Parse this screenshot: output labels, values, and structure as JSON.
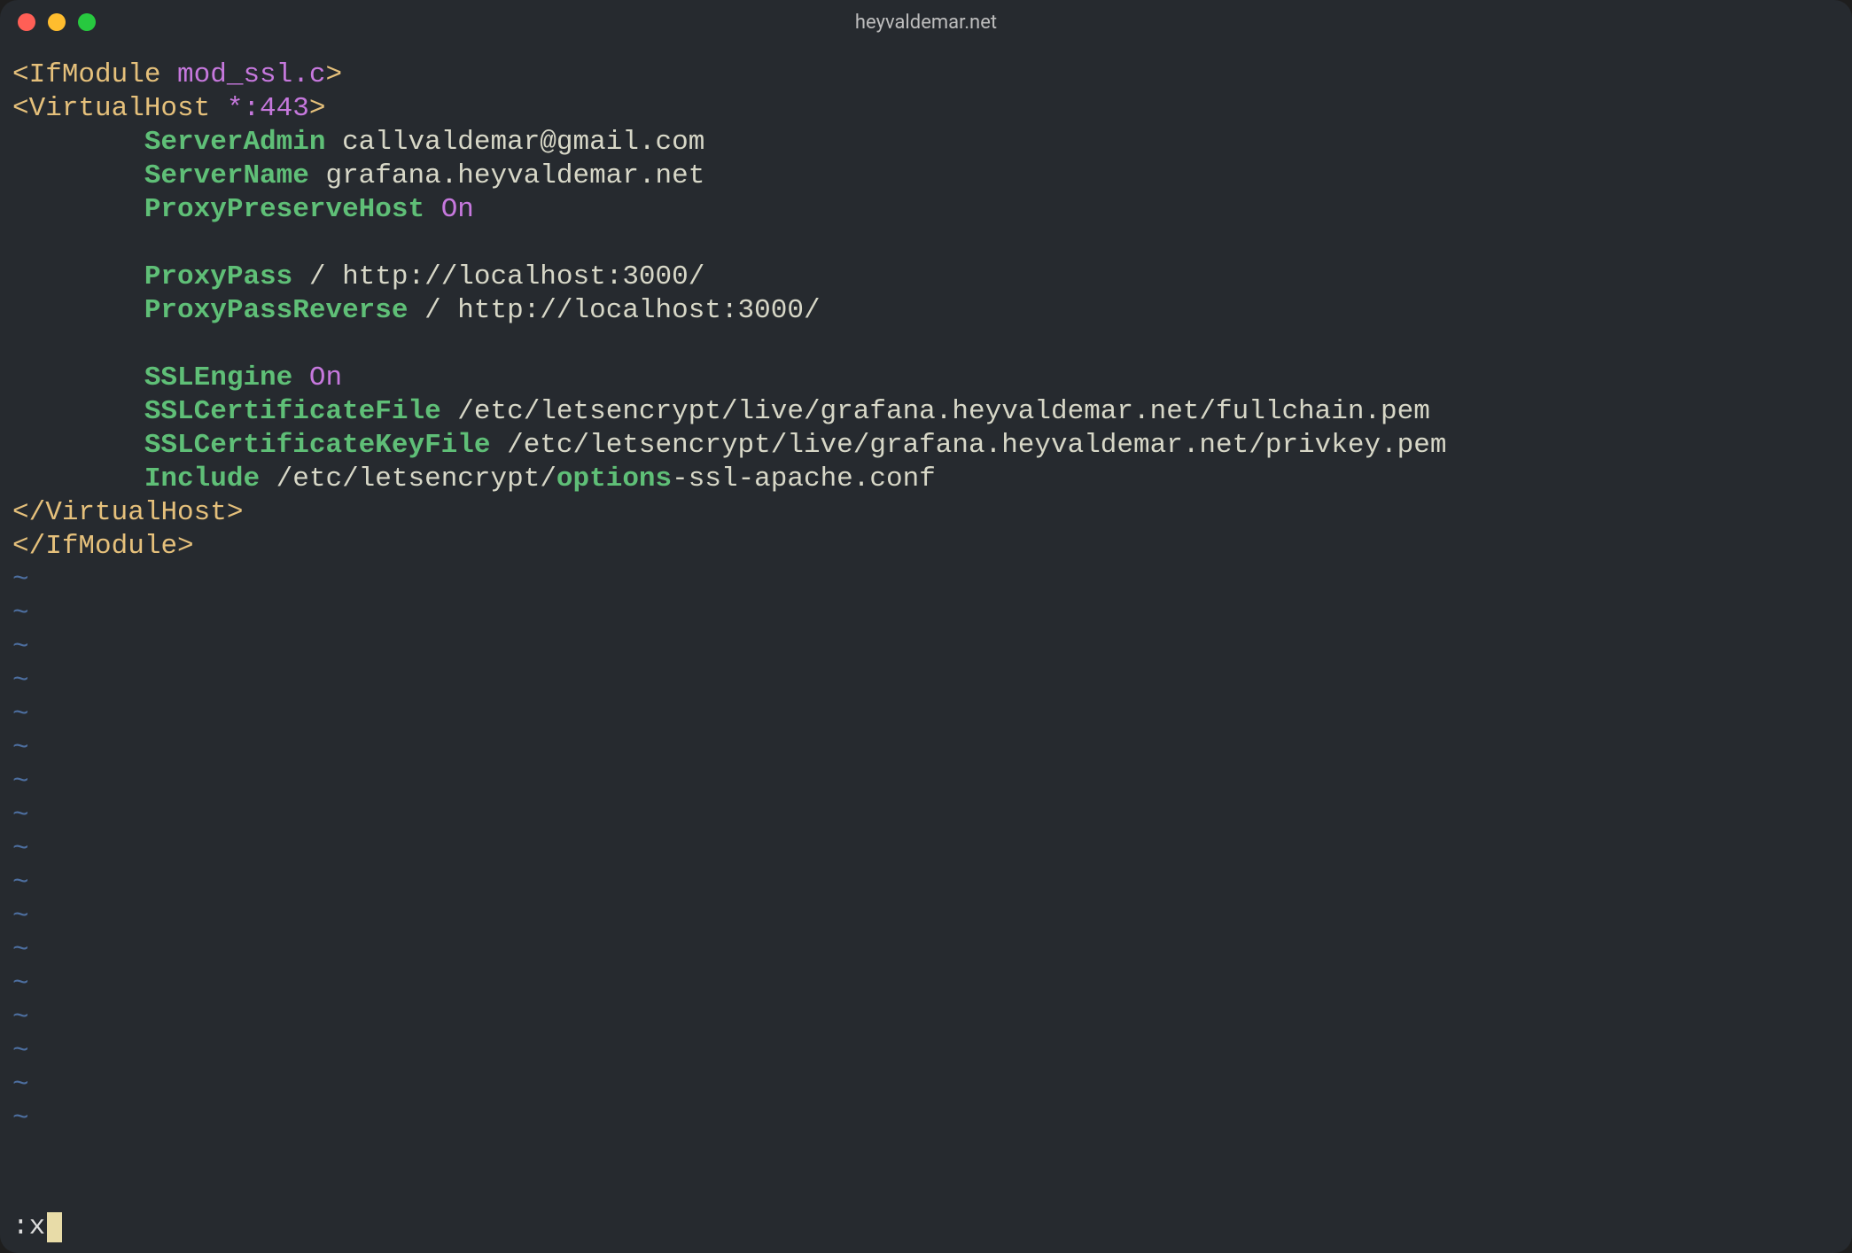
{
  "window": {
    "title": "heyvaldemar.net"
  },
  "code": {
    "line1_open": "<",
    "line1_tag": "IfModule",
    "line1_attr": " mod_ssl.c",
    "line1_close": ">",
    "line2_open": "<",
    "line2_tag": "VirtualHost",
    "line2_attr": " *:443",
    "line2_close": ">",
    "indent": "        ",
    "server_admin_kw": "ServerAdmin",
    "server_admin_val": " callvaldemar@gmail.com",
    "server_name_kw": "ServerName",
    "server_name_val": " grafana.heyvaldemar.net",
    "ppreserve_kw": "ProxyPreserveHost",
    "ppreserve_val": " On",
    "ppass_kw": "ProxyPass",
    "ppass_val": " / http://localhost:3000/",
    "ppassrev_kw": "ProxyPassReverse",
    "ppassrev_val": " / http://localhost:3000/",
    "sslengine_kw": "SSLEngine",
    "sslengine_val": " On",
    "sslcert_kw": "SSLCertificateFile",
    "sslcert_val": " /etc/letsencrypt/live/grafana.heyvaldemar.net/fullchain.pem",
    "sslkey_kw": "SSLCertificateKeyFile",
    "sslkey_val": " /etc/letsencrypt/live/grafana.heyvaldemar.net/privkey.pem",
    "include_kw": "Include",
    "include_pre": " /etc/letsencrypt/",
    "include_bold": "options",
    "include_post": "-ssl-apache.conf",
    "vhost_close_open": "</",
    "vhost_close_tag": "VirtualHost",
    "vhost_close_close": ">",
    "ifmod_close_open": "</",
    "ifmod_close_tag": "IfModule",
    "ifmod_close_close": ">"
  },
  "tilde": "~",
  "tilde_count": 17,
  "cmd": {
    "prefix": ":",
    "text": "x"
  }
}
